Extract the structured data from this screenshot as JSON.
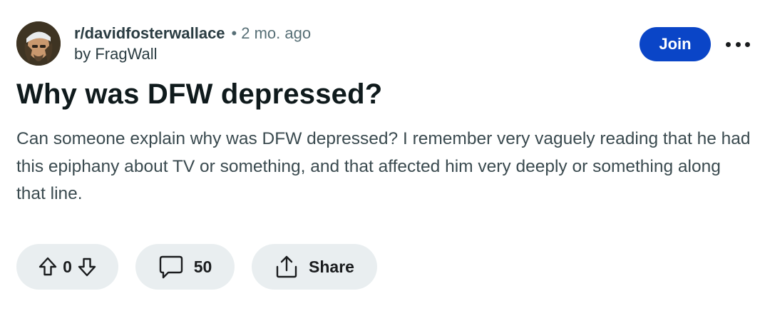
{
  "post": {
    "subreddit": "r/davidfosterwallace",
    "separator": "•",
    "time_ago": "2 mo. ago",
    "author": "by FragWall",
    "join_label": "Join",
    "title": "Why was DFW depressed?",
    "body": "Can someone explain why was DFW depressed? I remember very vaguely reading that he had this epiphany about TV or something, and that affected him very deeply or something along that line."
  },
  "actions": {
    "vote_count": "0",
    "comment_count": "50",
    "share_label": "Share"
  },
  "icons": {
    "upvote": "arrow-up-icon",
    "downvote": "arrow-down-icon",
    "comments": "comment-bubble-icon",
    "share": "share-icon",
    "more": "more-options-icon"
  },
  "colors": {
    "join_button": "#0a45c7",
    "pill_background": "#e9eef0",
    "muted_text": "#576f76"
  }
}
